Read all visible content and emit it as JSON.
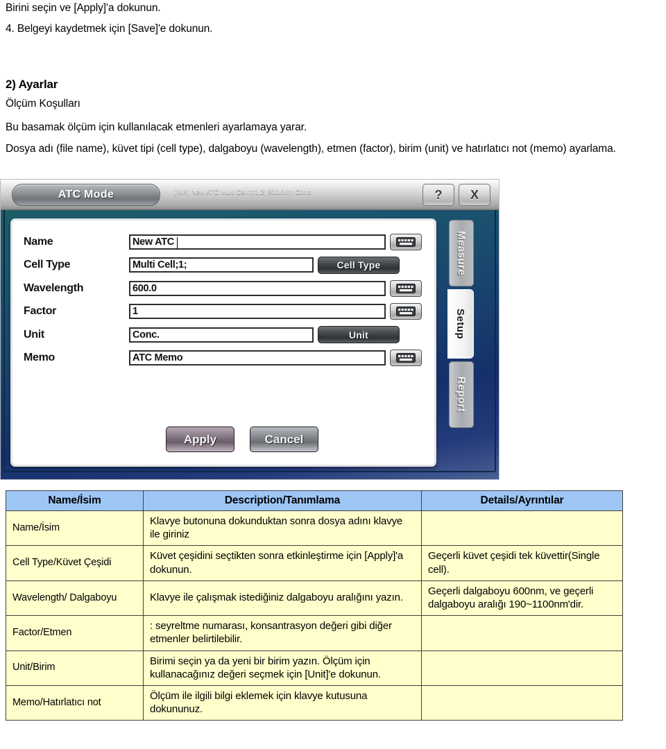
{
  "document": {
    "paragraph_1": "Birini seçin ve [Apply]'a dokunun.",
    "paragraph_2": "4. Belgeyi kaydetmek için [Save]'e dokunun.",
    "heading": "2) Ayarlar",
    "subheading": "Ölçüm Koşulları",
    "paragraph_3": "Bu basamak ölçüm için kullanılacak etmenleri ayarlamaya yarar.",
    "paragraph_4": "Dosya adı (file name), küvet tipi (cell type), dalgaboyu (wavelength), etmen (factor), birim (unit) ve hatırlatıcı not (memo) ayarlama."
  },
  "screenshot": {
    "titlebar": {
      "mode_label": "ATC Mode",
      "status_text": "(N/A) New ATC Multi Cell;0;1,2; 600.0nm Conc.",
      "help_label": "?",
      "close_label": "X"
    },
    "fields": [
      {
        "label": "Name",
        "value": "New ATC",
        "control": "keyboard-icon",
        "control_label": ""
      },
      {
        "label": "Cell Type",
        "value": "Multi Cell;1;",
        "control": "text-button",
        "control_label": "Cell Type"
      },
      {
        "label": "Wavelength",
        "value": "600.0",
        "control": "keyboard-icon",
        "control_label": ""
      },
      {
        "label": "Factor",
        "value": "1",
        "control": "keyboard-icon",
        "control_label": ""
      },
      {
        "label": "Unit",
        "value": "Conc.",
        "control": "text-button",
        "control_label": "Unit"
      },
      {
        "label": "Memo",
        "value": "ATC Memo",
        "control": "keyboard-icon",
        "control_label": ""
      }
    ],
    "actions": {
      "apply_label": "Apply",
      "cancel_label": "Cancel"
    },
    "side_tabs": [
      {
        "label": "Measure",
        "active": false
      },
      {
        "label": "Setup",
        "active": true
      },
      {
        "label": "Report",
        "active": false
      }
    ],
    "colors": {
      "header_blue": "#9dc6f5",
      "cell_yellow": "#ffffcc",
      "dialog_bg_top": "#1d5f63",
      "dialog_bg_bottom": "#243a7a"
    }
  },
  "table": {
    "headers": [
      "Name/İsim",
      "Description/Tanımlama",
      "Details/Ayrıntılar"
    ],
    "rows": [
      {
        "name": "Name/İsim",
        "description": "Klavye butonuna dokunduktan sonra dosya adını klavye ile giriniz",
        "details": ""
      },
      {
        "name": "Cell Type/Küvet Çeşidi",
        "description": "Küvet çeşidini seçtikten sonra etkinleştirme için [Apply]'a dokunun.",
        "details": "Geçerli küvet çeşidi tek küvettir(Single cell)."
      },
      {
        "name": "Wavelength/ Dalgaboyu",
        "description": "Klavye ile çalışmak istediğiniz dalgaboyu aralığını yazın.",
        "details": "Geçerli dalgaboyu 600nm,  ve geçerli dalgaboyu aralığı 190~1100nm'dir."
      },
      {
        "name": "Factor/Etmen",
        "description": ": seyreltme numarası, konsantrasyon değeri gibi diğer etmenler belirtilebilir.",
        "details": ""
      },
      {
        "name": "Unit/Birim",
        "description": "Birimi seçin ya da yeni bir birim yazın. Ölçüm için kullanacağınız değeri seçmek için [Unit]'e dokunun.",
        "details": ""
      },
      {
        "name": "Memo/Hatırlatıcı not",
        "description": "Ölçüm ile ilgili bilgi eklemek için klavye kutusuna dokununuz.",
        "details": ""
      }
    ]
  }
}
